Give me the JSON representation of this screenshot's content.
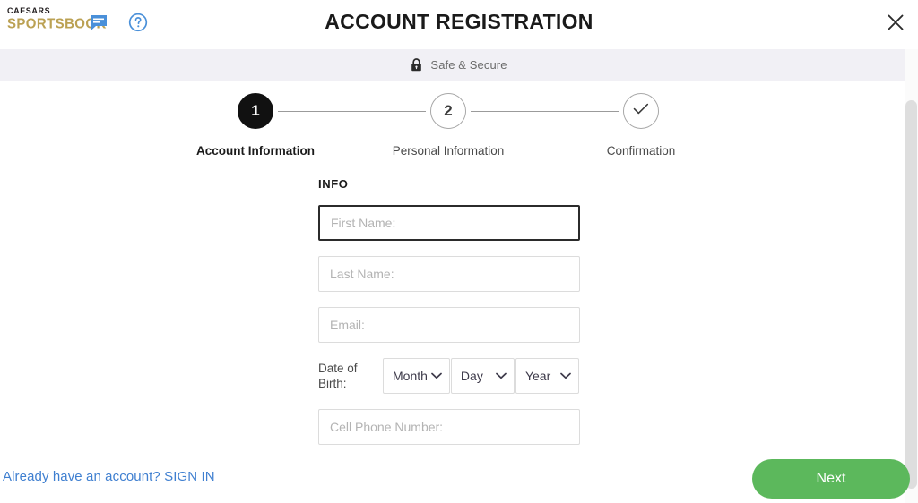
{
  "header": {
    "brand_top": "CAESARS",
    "brand_bottom": "SPORTSBOOK",
    "title": "ACCOUNT REGISTRATION",
    "chat_icon": "chat-icon",
    "help_icon": "help-circle-icon",
    "close_icon": "close-icon",
    "brand_gold": "#bba153",
    "icon_blue": "#4a90d9"
  },
  "secure_bar": {
    "lock_icon": "lock-icon",
    "text": "Safe & Secure",
    "background": "#f1f0f5"
  },
  "stepper": {
    "steps": [
      {
        "number": "1",
        "label": "Account Information",
        "state": "active"
      },
      {
        "number": "2",
        "label": "Personal Information",
        "state": "idle"
      },
      {
        "number": "✓",
        "label": "Confirmation",
        "state": "idle"
      }
    ]
  },
  "form": {
    "heading": "INFO",
    "fields": [
      {
        "name": "first-name",
        "placeholder": "First Name:",
        "value": "",
        "focused": true
      },
      {
        "name": "last-name",
        "placeholder": "Last Name:",
        "value": "",
        "focused": false
      },
      {
        "name": "email",
        "placeholder": "Email:",
        "value": "",
        "focused": false
      },
      {
        "name": "cell-phone",
        "placeholder": "Cell Phone Number:",
        "value": "",
        "focused": false
      }
    ],
    "dob": {
      "label_line1": "Date of",
      "label_line2": "Birth:",
      "month_value": "Month",
      "day_value": "Day",
      "year_value": "Year"
    }
  },
  "footer": {
    "signin_text": "Already have an account? SIGN IN",
    "signin_color": "#3f7fd0",
    "next_label": "Next",
    "next_color": "#5cb85c"
  },
  "scrollbar": {
    "thumb_color": "#dedede"
  }
}
